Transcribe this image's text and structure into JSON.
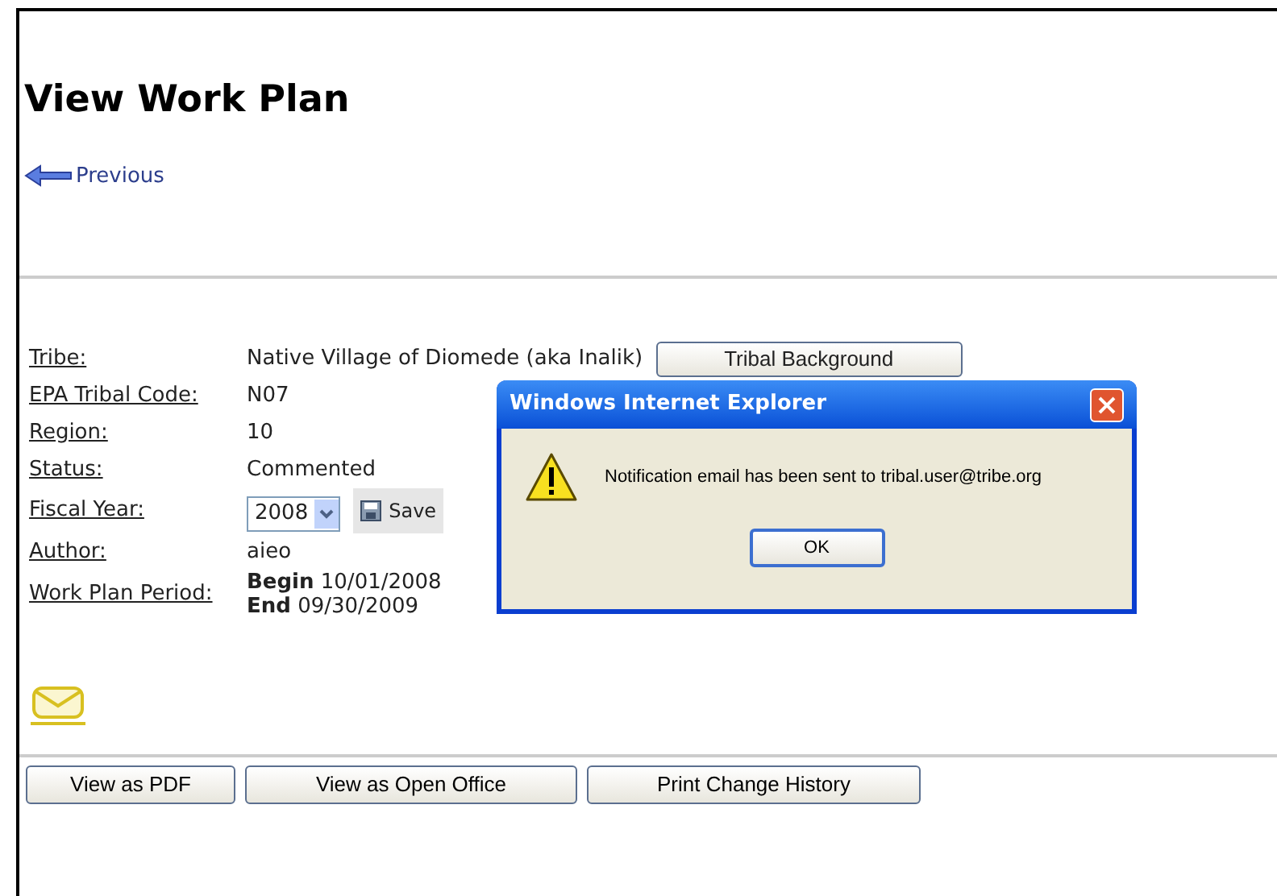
{
  "page": {
    "title": "View Work Plan",
    "previous": "Previous"
  },
  "fields": [
    {
      "kind": "text",
      "label": "Tribe:",
      "value": "Native Village of Diomede (aka Inalik)",
      "button": "Tribal Background"
    },
    {
      "kind": "text",
      "label": "EPA Tribal Code:",
      "value": "N07"
    },
    {
      "kind": "text",
      "label": "Region:",
      "value": "10"
    },
    {
      "kind": "text",
      "label": "Status:",
      "value": "Commented"
    },
    {
      "kind": "select",
      "label": "Fiscal Year:",
      "value": "2008",
      "button": "Save"
    },
    {
      "kind": "text",
      "label": "Author:",
      "value": "aieo"
    },
    {
      "kind": "period",
      "label": "Work Plan Period:",
      "begin_label": "Begin",
      "begin": "10/01/2008",
      "end_label": "End",
      "end": "09/30/2009"
    }
  ],
  "buttons": [
    "View as PDF",
    "View as Open Office",
    "Print Change History"
  ],
  "dialog": {
    "title": "Windows Internet Explorer",
    "message": "Notification email has been sent to tribal.user@tribe.org",
    "button": "OK"
  }
}
